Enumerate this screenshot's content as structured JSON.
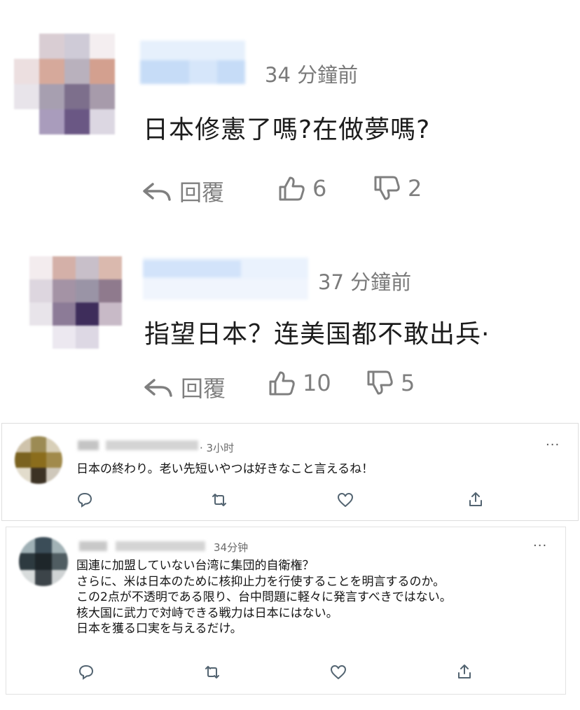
{
  "comments": [
    {
      "time": "34 分鐘前",
      "text": "日本修憲了嗎?在做夢嗎?",
      "reply_label": "回覆",
      "likes": "6",
      "dislikes": "2"
    },
    {
      "time": "37 分鐘前",
      "text": "指望日本？连美国都不敢出兵·",
      "reply_label": "回覆",
      "likes": "10",
      "dislikes": "5"
    }
  ],
  "tweets": [
    {
      "time": "· 3小时",
      "more": "···",
      "lines": [
        "日本の終わり。老い先短いやつは好きなこと言えるね！"
      ]
    },
    {
      "time": "34分钟",
      "more": "···",
      "lines": [
        "国連に加盟していない台湾に集団的自衛権？",
        "さらに、米は日本のために核抑止力を行使することを明言するのか。",
        "この2点が不透明である限り、台中問題に軽々に発言すべきではない。",
        "核大国に武力で対峙できる戦力は日本にはない。",
        "日本を獲る口実を与えるだけ。"
      ]
    }
  ],
  "icons": {
    "reply": "reply-arrow-icon",
    "like": "thumbs-up-icon",
    "dislike": "thumbs-down-icon",
    "comment": "speech-bubble-icon",
    "retweet": "retweet-icon",
    "heart": "heart-icon",
    "share": "share-icon"
  },
  "colors": {
    "text": "#1c1c1c",
    "muted": "#7a7a7a",
    "name_blur": "#c9dcf6"
  }
}
